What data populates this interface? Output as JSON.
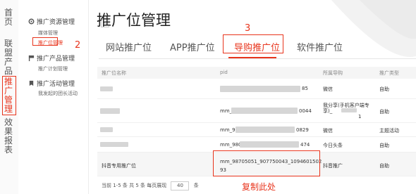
{
  "leftnav": {
    "items": [
      {
        "label": "首页"
      },
      {
        "label": "联盟产品"
      },
      {
        "label": "推广管理"
      },
      {
        "label": "效果报表"
      }
    ]
  },
  "subnav": {
    "collapse_label": "<",
    "groups": [
      {
        "label": "推广资源管理",
        "items": [
          "媒体管理",
          "推广位管理"
        ]
      },
      {
        "label": "推广产品管理",
        "items": [
          "推广计划管理"
        ]
      },
      {
        "label": "推广活动管理",
        "items": [
          "我发起的团长活动"
        ]
      }
    ]
  },
  "page": {
    "title": "推广位管理"
  },
  "tabs": [
    {
      "label": "网站推广位"
    },
    {
      "label": "APP推广位"
    },
    {
      "label": "导购推广位"
    },
    {
      "label": "软件推广位"
    }
  ],
  "table": {
    "columns": [
      "推广位名称",
      "pid",
      "所属导购",
      "推广类型"
    ],
    "rows": [
      {
        "name": "",
        "pid_prefix": "",
        "pid_suffix": "85",
        "guide": "微信",
        "type": "自助"
      },
      {
        "name": "",
        "pid_prefix": "mm_",
        "pid_suffix": "0044",
        "guide": "我分享(手机客户端专享)_",
        "guide2": "1",
        "type": "自助"
      },
      {
        "name": "",
        "pid_prefix": "mm_98",
        "pid_suffix": "0829",
        "guide": "微信",
        "type": "主题活动"
      },
      {
        "name": "",
        "pid_prefix": "mm_9807",
        "pid_suffix": "474",
        "guide": "今日头条",
        "type": "自助"
      },
      {
        "name": "抖音专用推广位",
        "pid": "mm_98705051_907750043_1094601502",
        "pid2": "93",
        "guide": "抖音推广",
        "type": "自助"
      }
    ]
  },
  "pager": {
    "summary": "当前 1-5 条  共 5 条  每页展现",
    "page_size": "40",
    "unit": "条"
  },
  "annotations": {
    "n1": "1",
    "n2": "2",
    "n3": "3",
    "copy_note": "复制此处"
  },
  "colors": {
    "accent": "#e8341c"
  }
}
